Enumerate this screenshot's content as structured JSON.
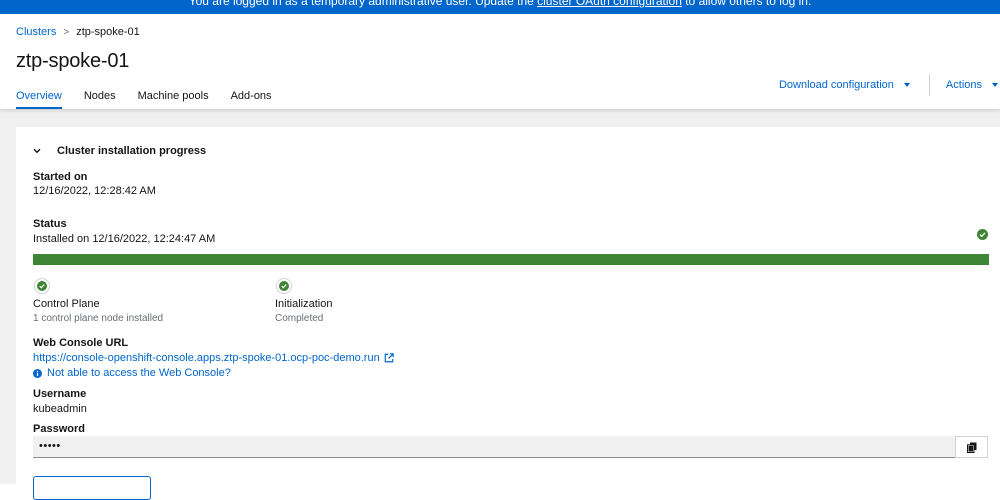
{
  "banner": {
    "prefix": "You are logged in as a temporary administrative user. Update the ",
    "link": "cluster OAuth configuration",
    "suffix": " to allow others to log in."
  },
  "breadcrumb": {
    "parent": "Clusters",
    "current": "ztp-spoke-01"
  },
  "page": {
    "title": "ztp-spoke-01"
  },
  "header_actions": {
    "download": "Download configuration",
    "actions": "Actions"
  },
  "tabs": [
    {
      "label": "Overview",
      "active": true
    },
    {
      "label": "Nodes",
      "active": false
    },
    {
      "label": "Machine pools",
      "active": false
    },
    {
      "label": "Add-ons",
      "active": false
    }
  ],
  "install": {
    "section_title": "Cluster installation progress",
    "started_label": "Started on",
    "started_value": "12/16/2022, 12:28:42 AM",
    "status_label": "Status",
    "status_value": "Installed on 12/16/2022, 12:24:47 AM",
    "progress_percent": 100,
    "steps": [
      {
        "title": "Control Plane",
        "detail": "1 control plane node installed"
      },
      {
        "title": "Initialization",
        "detail": "Completed"
      }
    ]
  },
  "console": {
    "label": "Web Console URL",
    "url": "https://console-openshift-console.apps.ztp-spoke-01.ocp-poc-demo.run",
    "help": "Not able to access the Web Console?"
  },
  "credentials": {
    "username_label": "Username",
    "username": "kubeadmin",
    "password_label": "Password",
    "password_mask": "•••••"
  },
  "colors": {
    "accent": "#0066cc",
    "success": "#3e8635",
    "banner": "#0066cc",
    "page_bg": "#f0f0f0"
  }
}
